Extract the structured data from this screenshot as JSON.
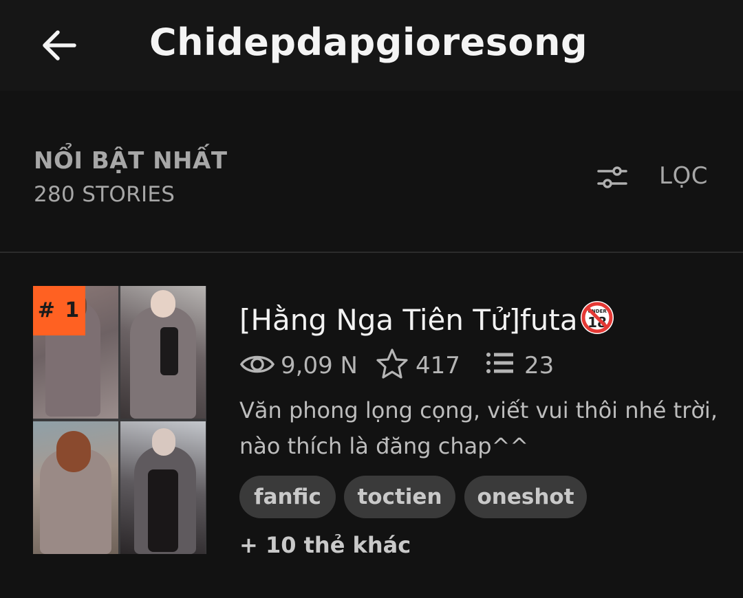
{
  "header": {
    "title": "Chidepdapgioresong",
    "back_icon": "arrow-left-icon"
  },
  "section": {
    "sort_label": "NỔI BẬT NHẤT",
    "count_label": "280 STORIES",
    "filter_label": "LỌC",
    "filter_icon": "sliders-icon"
  },
  "story": {
    "rank": "# 1",
    "title": "[Hằng Nga Tiên Tử]futa",
    "age_icon": "no-under-18-icon",
    "reads": "9,09 N",
    "votes": "417",
    "parts": "23",
    "description": "Văn phong lọng cọng, viết vui thôi nhé trời, nào thích là đăng chap^^",
    "tags": [
      "fanfic",
      "toctien",
      "oneshot"
    ],
    "more_tags": "+ 10 thẻ khác"
  },
  "colors": {
    "background": "#121212",
    "appbar": "#161616",
    "accent": "#ff6122",
    "tag_bg": "#3a3a3a"
  }
}
